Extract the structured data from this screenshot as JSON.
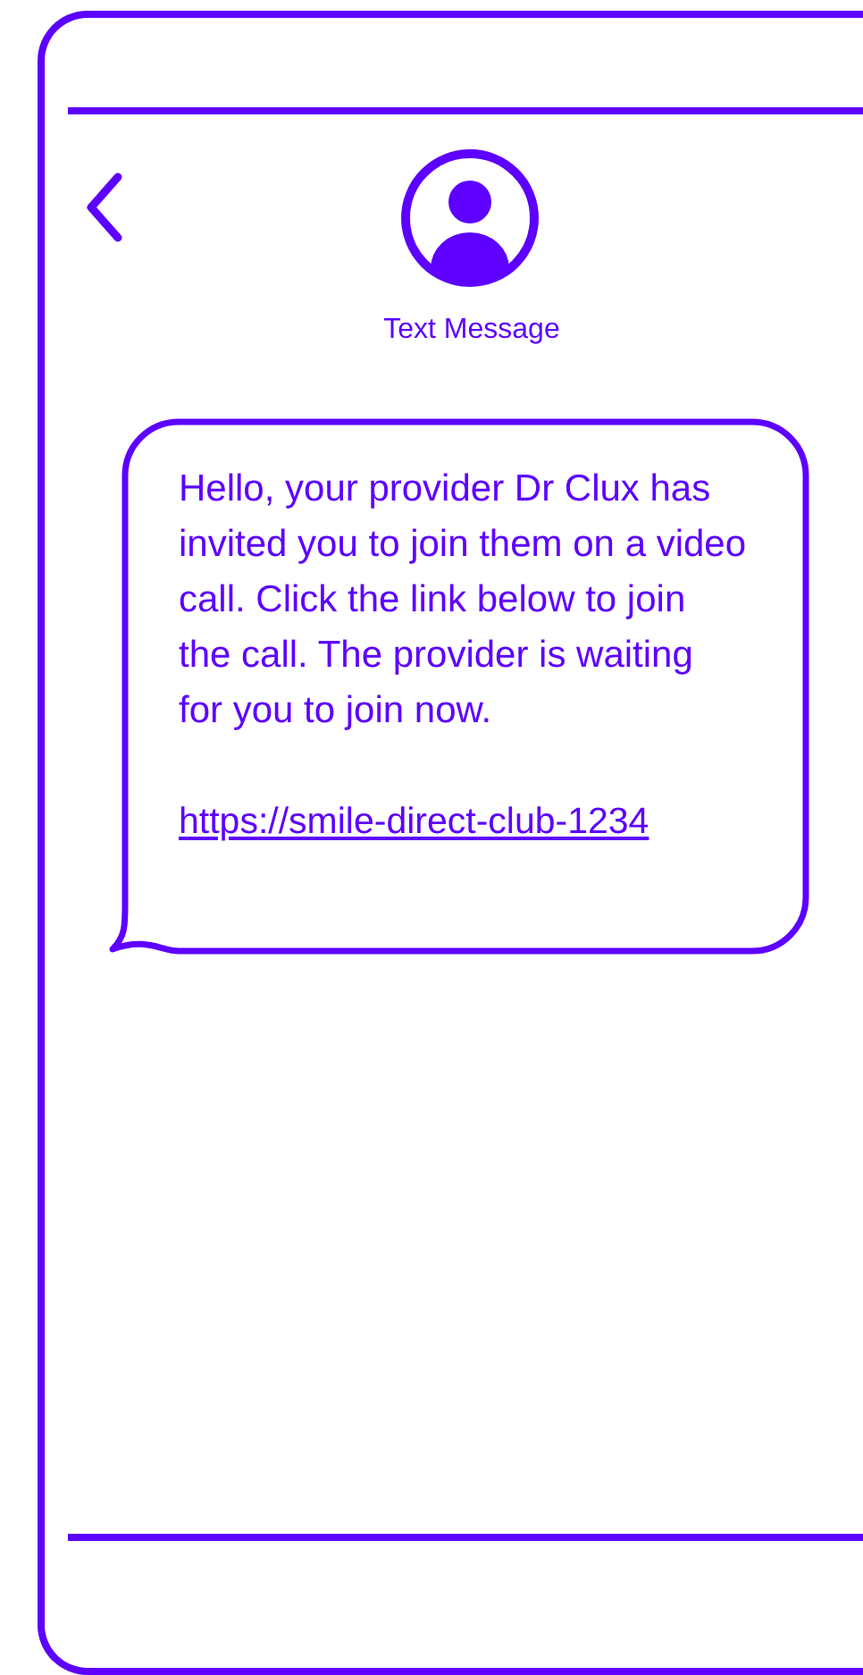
{
  "header": {
    "title": "Text Message"
  },
  "message": {
    "text": "Hello, your provider Dr Clux has invited you to join them on a video call. Click the link below to join the call. The provider is waiting for you to join now.",
    "link": "https://smile-direct-club-1234"
  }
}
